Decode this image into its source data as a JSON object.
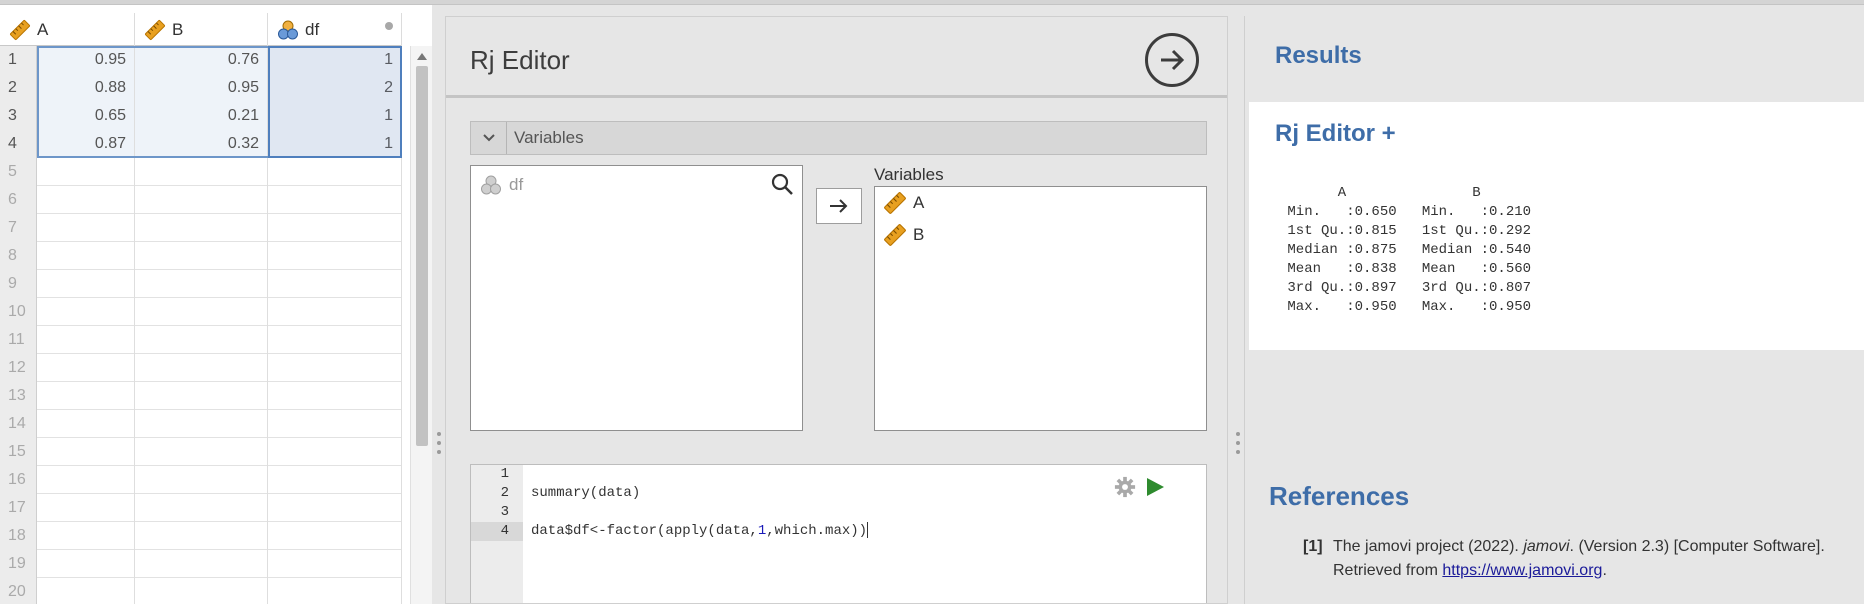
{
  "spreadsheet": {
    "columns": [
      {
        "name": "A",
        "type": "continuous"
      },
      {
        "name": "B",
        "type": "continuous"
      },
      {
        "name": "df",
        "type": "nominal"
      }
    ],
    "row_numbers": [
      "1",
      "2",
      "3",
      "4",
      "5",
      "6",
      "7",
      "8",
      "9",
      "10",
      "11",
      "12",
      "13",
      "14",
      "15",
      "16",
      "17",
      "18",
      "19",
      "20"
    ],
    "rows": [
      {
        "A": "0.95",
        "B": "0.76",
        "df": "1"
      },
      {
        "A": "0.88",
        "B": "0.95",
        "df": "2"
      },
      {
        "A": "0.65",
        "B": "0.21",
        "df": "1"
      },
      {
        "A": "0.87",
        "B": "0.32",
        "df": "1"
      }
    ]
  },
  "options": {
    "title": "Rj Editor",
    "variables_section_label": "Variables",
    "source_list": [
      "df"
    ],
    "target_label": "Variables",
    "target_list": [
      "A",
      "B"
    ],
    "code": {
      "line_numbers": [
        "1",
        "2",
        "3",
        "4"
      ],
      "lines": [
        "",
        "summary(data)",
        "",
        "data$df<-factor(apply(data,1,which.max))"
      ]
    }
  },
  "results": {
    "title": "Results",
    "card_title": "Rj Editor +",
    "summary_output": "       A               B         \n Min.   :0.650   Min.   :0.210  \n 1st Qu.:0.815   1st Qu.:0.292  \n Median :0.875   Median :0.540  \n Mean   :0.838   Mean   :0.560  \n 3rd Qu.:0.897   3rd Qu.:0.807  \n Max.   :0.950   Max.   :0.950  ",
    "references_title": "References",
    "references": [
      {
        "num": "[1]",
        "authors": "The jamovi project (2022).",
        "work": "jamovi",
        "rest": ". (Version 2.3) [Computer Software]. Retrieved from ",
        "link": "https://www.jamovi.org",
        "end": "."
      }
    ]
  },
  "colors": {
    "accent": "#3e6da8",
    "selection": "#4f7fbd",
    "run_green": "#2e8b2e",
    "ruler_icon": "#e8a020"
  },
  "icons": {
    "continuous_column": "ruler-icon",
    "nominal_column": "circles-icon",
    "run": "arrow-circle-icon",
    "move": "arrow-right-icon",
    "search": "search-icon",
    "settings": "gear-icon",
    "execute": "play-icon"
  }
}
